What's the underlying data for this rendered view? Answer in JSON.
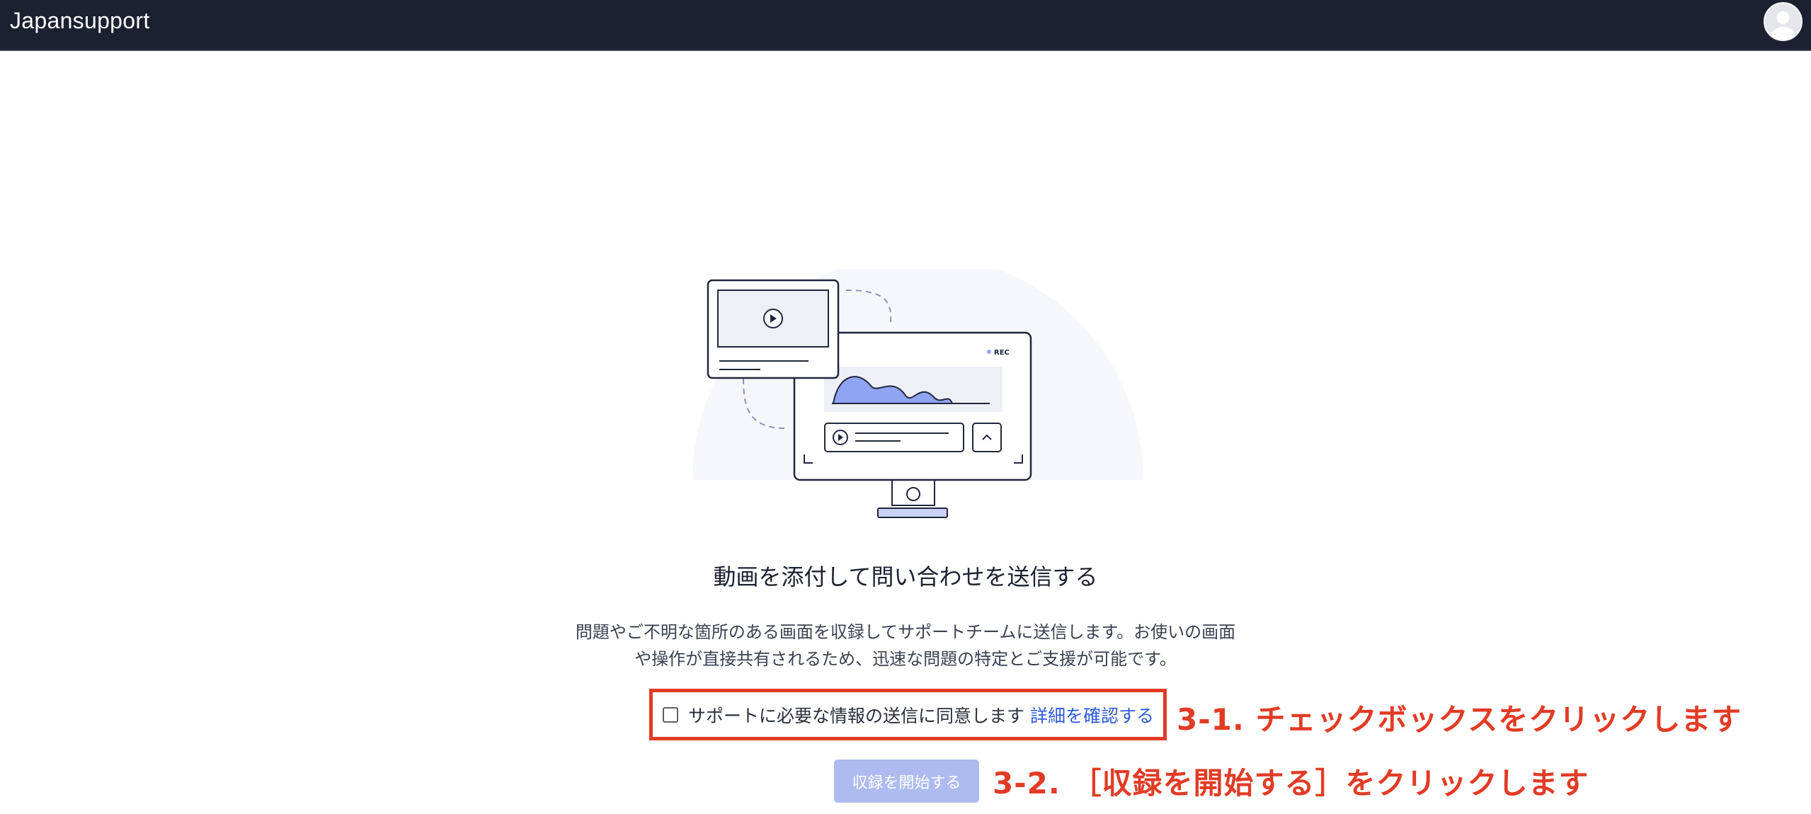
{
  "header": {
    "app_name": "Japansupport",
    "avatar_icon": "user-avatar-icon"
  },
  "illustration": {
    "rec_label": "REC",
    "accent_color": "#8fa4f2"
  },
  "main": {
    "title": "動画を添付して問い合わせを送信する",
    "description_line1": "問題やご不明な箇所のある画面を収録してサポートチームに送信します。お使いの画面",
    "description_line2": "や操作が直接共有されるため、迅速な問題の特定とご支援が可能です。",
    "consent_label": "サポートに必要な情報の送信に同意します",
    "consent_checked": false,
    "consent_link": "詳細を確認する",
    "start_button": "収録を開始する",
    "start_button_disabled": true
  },
  "annotations": {
    "step1": "3-1. チェックボックスをクリックします",
    "step2": "3-2. ［収録を開始する］をクリックします",
    "color": "#e23b25"
  }
}
